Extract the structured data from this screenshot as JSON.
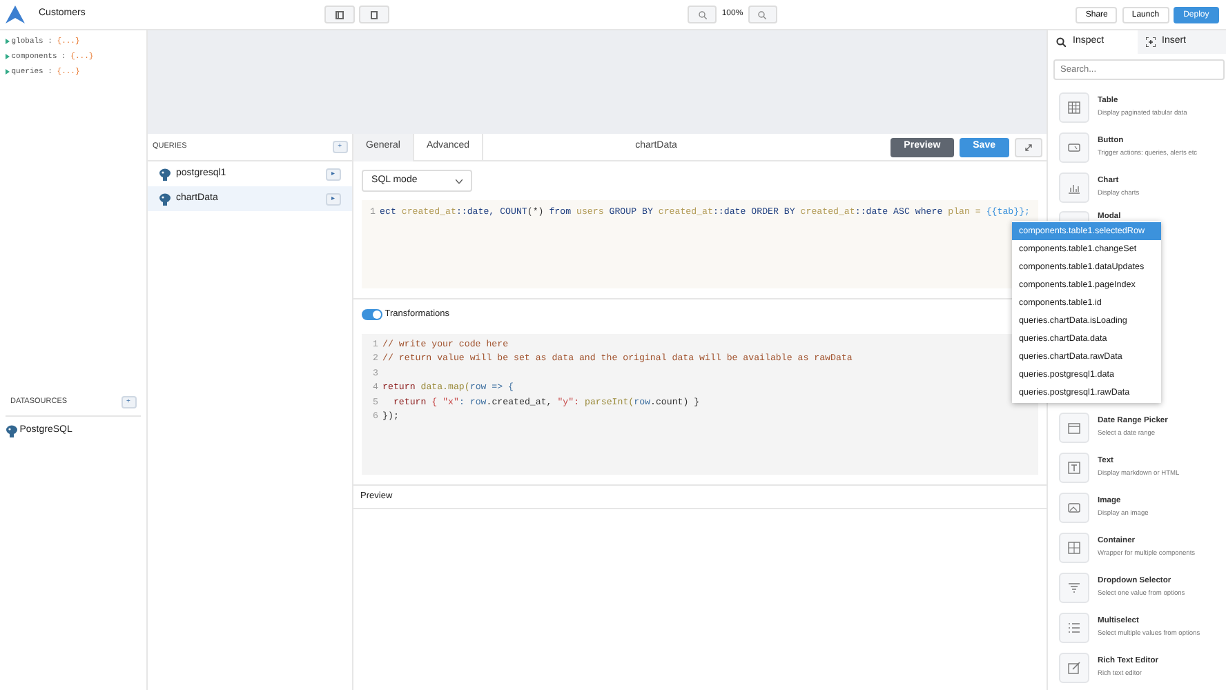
{
  "app": {
    "title": "Customers",
    "zoom": "100%",
    "actions": [
      {
        "label": "Share",
        "kind": "light"
      },
      {
        "label": "Launch",
        "kind": "light"
      },
      {
        "label": "Deploy",
        "kind": "primary"
      }
    ]
  },
  "inspector_tree": [
    {
      "key": "globals",
      "sep": ":",
      "value": "{...}"
    },
    {
      "key": "components",
      "sep": ":",
      "value": "{...}"
    },
    {
      "key": "queries",
      "sep": ":",
      "value": "{...}"
    }
  ],
  "datasources": {
    "title": "DATASOURCES",
    "add": "+",
    "items": [
      {
        "name": "PostgreSQL"
      }
    ]
  },
  "queries": {
    "title": "QUERIES",
    "add": "+",
    "items": [
      {
        "name": "postgresql1",
        "run": "▸",
        "selected": false
      },
      {
        "name": "chartData",
        "run": "▸",
        "selected": true
      }
    ]
  },
  "editor": {
    "tabs": [
      {
        "label": "General",
        "selected": true
      },
      {
        "label": "Advanced",
        "selected": false
      }
    ],
    "query_name": "chartData",
    "buttons": [
      {
        "label": "Preview",
        "kind": "dark"
      },
      {
        "label": "Save",
        "kind": "primary"
      }
    ],
    "mode": "SQL mode",
    "sql_lines": [
      {
        "number": "1",
        "tokens": [
          {
            "t": "ect ",
            "color": "#1f3f80"
          },
          {
            "t": "created_at",
            "color": "#b39c58"
          },
          {
            "t": "::date, COUNT",
            "color": "#1f3f80"
          },
          {
            "t": "(*) ",
            "color": "#333333"
          },
          {
            "t": "from ",
            "color": "#1f3f80"
          },
          {
            "t": "users ",
            "color": "#b39c58"
          },
          {
            "t": "GROUP BY ",
            "color": "#1f3f80"
          },
          {
            "t": "created_at",
            "color": "#b39c58"
          },
          {
            "t": "::date ORDER BY ",
            "color": "#1f3f80"
          },
          {
            "t": "created_at",
            "color": "#b39c58"
          },
          {
            "t": "::date ASC where ",
            "color": "#1f3f80"
          },
          {
            "t": "plan = ",
            "color": "#b39c58"
          },
          {
            "t": "{{tab}};",
            "color": "#3c92dc"
          }
        ]
      }
    ],
    "transformations": {
      "label": "Transformations",
      "on": true
    },
    "js_lines": [
      {
        "number": "1",
        "tokens": [
          {
            "t": "// write your code here",
            "color": "#a0522d"
          }
        ]
      },
      {
        "number": "2",
        "tokens": [
          {
            "t": "// return value will be set as data and the original data will be available as rawData",
            "color": "#a0522d"
          }
        ]
      },
      {
        "number": "3"
      },
      {
        "number": "4",
        "tokens": [
          {
            "t": "return ",
            "color": "#8b1a1a"
          },
          {
            "t": "data.map(",
            "color": "#9a8a3a"
          },
          {
            "t": "row => {",
            "color": "#3d6fa0"
          }
        ]
      },
      {
        "number": "5",
        "tokens": [
          {
            "t": "  return ",
            "color": "#8b1a1a"
          },
          {
            "t": "{ \"x\"",
            "color": "#c74b4b"
          },
          {
            "t": ": row",
            "color": "#3d6fa0"
          },
          {
            "t": ".created_at, ",
            "color": "#333333"
          },
          {
            "t": "\"y\": ",
            "color": "#c74b4b"
          },
          {
            "t": "parseInt(",
            "color": "#9a8a3a"
          },
          {
            "t": "row",
            "color": "#3d6fa0"
          },
          {
            "t": ".count) }",
            "color": "#333333"
          }
        ]
      },
      {
        "number": "6",
        "tokens": [
          {
            "t": "});",
            "color": "#333333"
          }
        ]
      }
    ],
    "preview_label": "Preview"
  },
  "autocomplete": [
    {
      "label": "components.table1.selectedRow",
      "selected": true
    },
    {
      "label": "components.table1.changeSet",
      "selected": false
    },
    {
      "label": "components.table1.dataUpdates",
      "selected": false
    },
    {
      "label": "components.table1.pageIndex",
      "selected": false
    },
    {
      "label": "components.table1.id",
      "selected": false
    },
    {
      "label": "queries.chartData.isLoading",
      "selected": false
    },
    {
      "label": "queries.chartData.data",
      "selected": false
    },
    {
      "label": "queries.chartData.rawData",
      "selected": false
    },
    {
      "label": "queries.postgresql1.data",
      "selected": false
    },
    {
      "label": "queries.postgresql1.rawData",
      "selected": false
    }
  ],
  "sidebar": {
    "tabs": [
      {
        "label": "Inspect",
        "kind": "inspect",
        "selected": true
      },
      {
        "label": "Insert",
        "kind": "insert",
        "selected": false
      }
    ],
    "search": {
      "placeholder": "Search..."
    },
    "components": [
      {
        "name": "Table",
        "description": "Display paginated tabular data",
        "kind": "table"
      },
      {
        "name": "Button",
        "description": "Trigger actions: queries, alerts etc",
        "kind": "button"
      },
      {
        "name": "Chart",
        "description": "Display charts",
        "kind": "chart"
      },
      {
        "name": "Modal",
        "kind": "modal"
      },
      {
        "name": "Date Range Picker",
        "description": "Select a date range",
        "kind": "calendar"
      },
      {
        "name": "Text",
        "description": "Display markdown or HTML",
        "kind": "text"
      },
      {
        "name": "Image",
        "description": "Display an image",
        "kind": "image"
      },
      {
        "name": "Container",
        "description": "Wrapper for multiple components",
        "kind": "container"
      },
      {
        "name": "Dropdown Selector",
        "description": "Select one value from options",
        "kind": "dropdown"
      },
      {
        "name": "Multiselect",
        "description": "Select multiple values from options",
        "kind": "list"
      },
      {
        "name": "Rich Text Editor",
        "description": "Rich text editor",
        "kind": "editor"
      }
    ]
  }
}
